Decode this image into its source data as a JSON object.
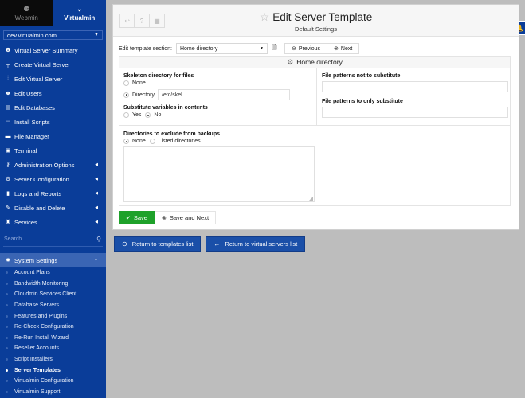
{
  "sidebar": {
    "switch": {
      "webmin_label": "Webmin",
      "webmin_icon": "webmin-logo-icon",
      "virtualmin_label": "Virtualmin",
      "virtualmin_icon": "chevron-down-icon"
    },
    "domain_select": {
      "value": "dev.virtualmin.com"
    },
    "items": [
      {
        "label": "Virtual Server Summary",
        "icon": "info-icon",
        "glyph": "❶",
        "has_arrow": false
      },
      {
        "label": "Create Virtual Server",
        "icon": "create-server-icon",
        "glyph": "╤",
        "has_arrow": false
      },
      {
        "label": "Edit Virtual Server",
        "icon": "sliders-icon",
        "glyph": "⫶",
        "has_arrow": false
      },
      {
        "label": "Edit Users",
        "icon": "users-icon",
        "glyph": "☻",
        "has_arrow": false
      },
      {
        "label": "Edit Databases",
        "icon": "database-icon",
        "glyph": "▤",
        "has_arrow": false
      },
      {
        "label": "Install Scripts",
        "icon": "scripts-icon",
        "glyph": "▭",
        "has_arrow": false
      },
      {
        "label": "File Manager",
        "icon": "folder-icon",
        "glyph": "▬",
        "has_arrow": false
      },
      {
        "label": "Terminal",
        "icon": "terminal-icon",
        "glyph": "▣",
        "has_arrow": false
      },
      {
        "label": "Administration Options",
        "icon": "key-icon",
        "glyph": "⚷",
        "has_arrow": true
      },
      {
        "label": "Server Configuration",
        "icon": "cogs-icon",
        "glyph": "⚙",
        "has_arrow": true
      },
      {
        "label": "Logs and Reports",
        "icon": "file-icon",
        "glyph": "▮",
        "has_arrow": true
      },
      {
        "label": "Disable and Delete",
        "icon": "plug-icon",
        "glyph": "✎",
        "has_arrow": true
      },
      {
        "label": "Services",
        "icon": "sitemap-icon",
        "glyph": "♜",
        "has_arrow": true
      }
    ],
    "search_placeholder": "Search",
    "system_settings": {
      "label": "System Settings",
      "items": [
        {
          "label": "Account Plans",
          "active": false
        },
        {
          "label": "Bandwidth Monitoring",
          "active": false
        },
        {
          "label": "Cloudmin Services Client",
          "active": false
        },
        {
          "label": "Database Servers",
          "active": false
        },
        {
          "label": "Features and Plugins",
          "active": false
        },
        {
          "label": "Re-Check Configuration",
          "active": false
        },
        {
          "label": "Re-Run Install Wizard",
          "active": false
        },
        {
          "label": "Reseller Accounts",
          "active": false
        },
        {
          "label": "Script Installers",
          "active": false
        },
        {
          "label": "Server Templates",
          "active": true
        },
        {
          "label": "Virtualmin Configuration",
          "active": false
        },
        {
          "label": "Virtualmin Support",
          "active": false
        }
      ]
    }
  },
  "header": {
    "title": "Edit Server Template",
    "subtitle": "Default Settings"
  },
  "section_bar": {
    "label": "Edit template section:",
    "selected": "Home directory",
    "previous_label": "Previous",
    "next_label": "Next"
  },
  "form": {
    "title": "Home directory",
    "skeleton": {
      "label": "Skeleton directory for files",
      "option_none": "None",
      "option_directory": "Directory",
      "selected": "Directory",
      "directory_value": "/etc/skel"
    },
    "substitute": {
      "label": "Substitute variables in contents",
      "option_yes": "Yes",
      "option_no": "No",
      "selected": "No"
    },
    "patterns_not": {
      "label": "File patterns not to substitute",
      "value": ""
    },
    "patterns_only": {
      "label": "File patterns to only substitute",
      "value": ""
    },
    "exclude_backups": {
      "label": "Directories to exclude from backups",
      "option_none": "None",
      "option_listed": "Listed directories ..",
      "selected": "None",
      "value": ""
    }
  },
  "actions": {
    "save_label": "Save",
    "save_next_label": "Save and Next",
    "return_templates_label": "Return to templates list",
    "return_servers_label": "Return to virtual servers list"
  },
  "colors": {
    "sidebar_bg": "#0a3d99",
    "save_green": "#1ea12a",
    "return_blue": "#1a4fa8"
  }
}
